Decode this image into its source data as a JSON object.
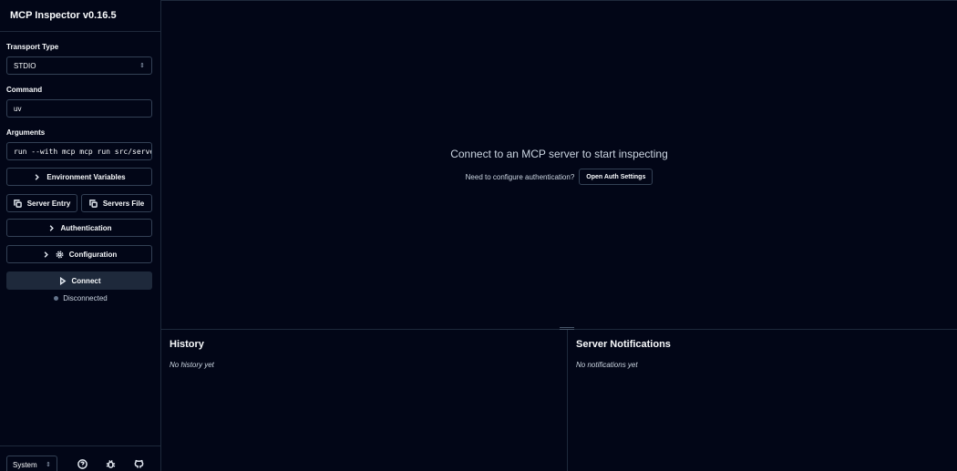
{
  "app": {
    "title": "MCP Inspector v0.16.5"
  },
  "sidebar": {
    "transport": {
      "label": "Transport Type",
      "value": "STDIO"
    },
    "command": {
      "label": "Command",
      "value": "uv"
    },
    "arguments": {
      "label": "Arguments",
      "value": "run --with mcp mcp run src/server/"
    },
    "env_vars_label": "Environment Variables",
    "server_entry_label": "Server Entry",
    "servers_file_label": "Servers File",
    "authentication_label": "Authentication",
    "configuration_label": "Configuration",
    "connect_label": "Connect",
    "status_text": "Disconnected",
    "theme": {
      "value": "System"
    }
  },
  "main": {
    "empty_title": "Connect to an MCP server to start inspecting",
    "auth_prompt": "Need to configure authentication?",
    "auth_button_label": "Open Auth Settings"
  },
  "history": {
    "title": "History",
    "empty": "No history yet"
  },
  "notifications": {
    "title": "Server Notifications",
    "empty": "No notifications yet"
  },
  "colors": {
    "background": "#020617",
    "border": "#1e293b",
    "primary_button": "#1e293b",
    "status_dot": "#64748b"
  }
}
